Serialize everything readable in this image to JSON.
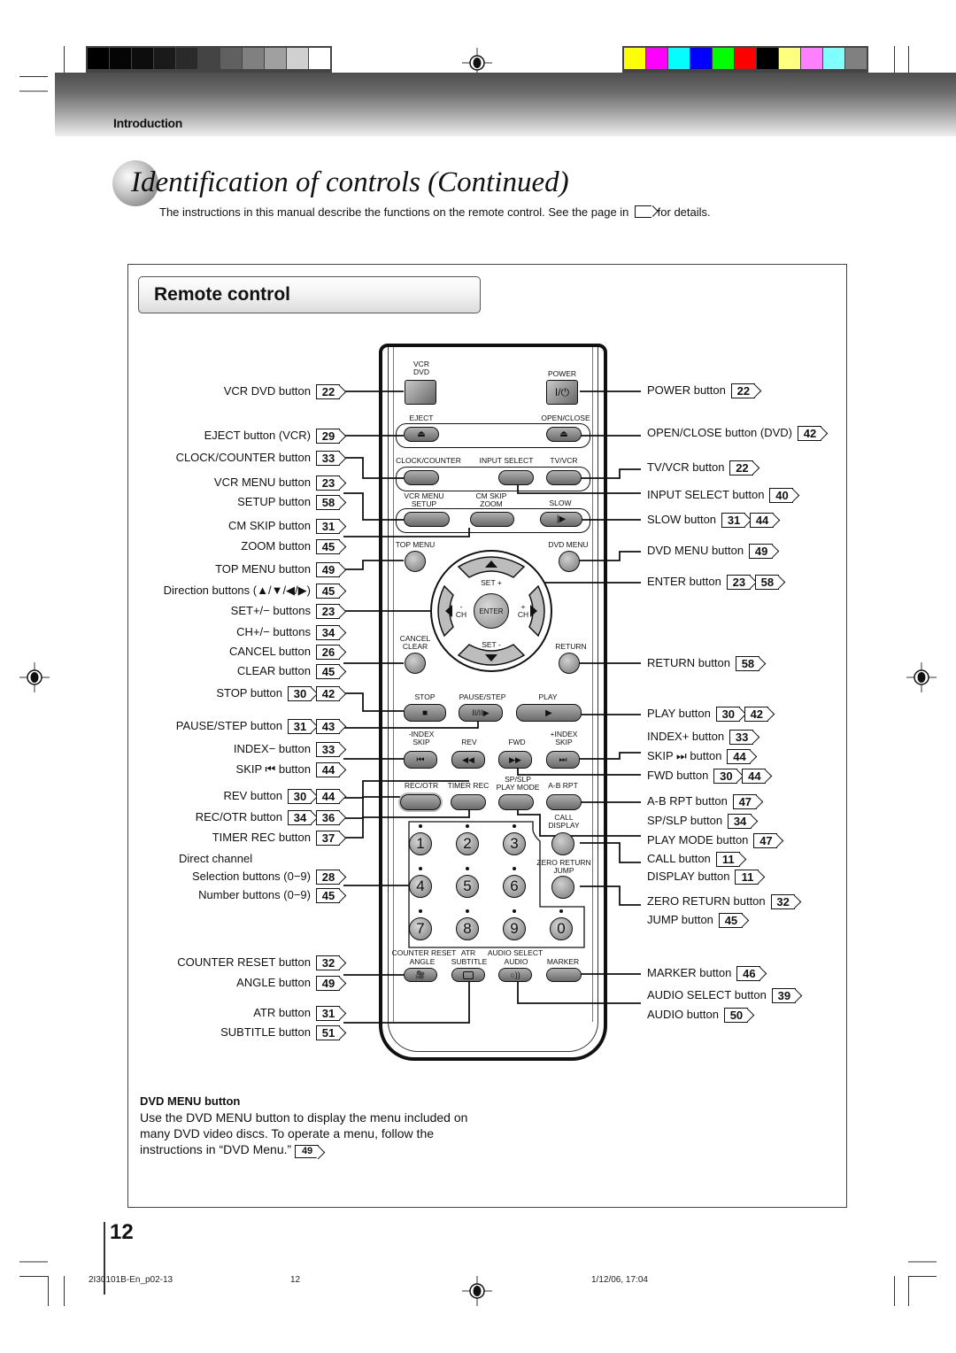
{
  "print_marks": {
    "grayscale_bar": [
      "#000000",
      "#050505",
      "#0d0d0d",
      "#1a1a1a",
      "#2a2a2a",
      "#444444",
      "#606060",
      "#808080",
      "#a0a0a0",
      "#d0d0d0",
      "#ffffff"
    ],
    "color_bar": [
      "#ffff00",
      "#ff00ff",
      "#00ffff",
      "#0000ff",
      "#00ff00",
      "#ff0000",
      "#000000",
      "#ffff80",
      "#ff80ff",
      "#80ffff",
      "#808080"
    ]
  },
  "header": {
    "section": "Introduction",
    "title": "Identification of controls (Continued)",
    "subtitle_before": "The instructions in this manual describe the functions on the remote control. See the page in",
    "subtitle_after": "for details."
  },
  "remote_section": {
    "heading": "Remote control"
  },
  "left_labels": [
    {
      "text": "VCR DVD button",
      "refs": [
        "22"
      ]
    },
    {
      "text": "EJECT button (VCR)",
      "refs": [
        "29"
      ]
    },
    {
      "text": "CLOCK/COUNTER button",
      "refs": [
        "33"
      ]
    },
    {
      "text": "VCR MENU button",
      "refs": [
        "23"
      ]
    },
    {
      "text": "SETUP button",
      "refs": [
        "58"
      ]
    },
    {
      "text": "CM SKIP button",
      "refs": [
        "31"
      ]
    },
    {
      "text": "ZOOM button",
      "refs": [
        "45"
      ]
    },
    {
      "text": "TOP MENU button",
      "refs": [
        "49"
      ]
    },
    {
      "text": "Direction buttons (▲/▼/◀/▶)",
      "refs": [
        "45"
      ]
    },
    {
      "text": "SET+/− buttons",
      "refs": [
        "23"
      ]
    },
    {
      "text": "CH+/− buttons",
      "refs": [
        "34"
      ]
    },
    {
      "text": "CANCEL button",
      "refs": [
        "26"
      ]
    },
    {
      "text": "CLEAR button",
      "refs": [
        "45"
      ]
    },
    {
      "text": "STOP button",
      "refs": [
        "30",
        "42"
      ]
    },
    {
      "text": "PAUSE/STEP button",
      "refs": [
        "31",
        "43"
      ]
    },
    {
      "text": "INDEX− button",
      "refs": [
        "33"
      ]
    },
    {
      "text": "SKIP ⏮ button",
      "refs": [
        "44"
      ]
    },
    {
      "text": "REV button",
      "refs": [
        "30",
        "44"
      ]
    },
    {
      "text": "REC/OTR button",
      "refs": [
        "34",
        "36"
      ]
    },
    {
      "text": "TIMER REC button",
      "refs": [
        "37"
      ]
    },
    {
      "text": "Direct channel",
      "refs": []
    },
    {
      "text": "Selection buttons (0−9)",
      "refs": [
        "28"
      ]
    },
    {
      "text": "Number buttons (0−9)",
      "refs": [
        "45"
      ]
    },
    {
      "text": "COUNTER RESET button",
      "refs": [
        "32"
      ]
    },
    {
      "text": "ANGLE button",
      "refs": [
        "49"
      ]
    },
    {
      "text": "ATR button",
      "refs": [
        "31"
      ]
    },
    {
      "text": "SUBTITLE button",
      "refs": [
        "51"
      ]
    }
  ],
  "right_labels": [
    {
      "text": "POWER button",
      "refs": [
        "22"
      ]
    },
    {
      "text": "OPEN/CLOSE button (DVD)",
      "refs": [
        "42"
      ]
    },
    {
      "text": "TV/VCR button",
      "refs": [
        "22"
      ]
    },
    {
      "text": "INPUT SELECT button",
      "refs": [
        "40"
      ]
    },
    {
      "text": "SLOW button",
      "refs": [
        "31",
        "44"
      ]
    },
    {
      "text": "DVD MENU button",
      "refs": [
        "49"
      ]
    },
    {
      "text": "ENTER button",
      "refs": [
        "23",
        "58"
      ]
    },
    {
      "text": "RETURN button",
      "refs": [
        "58"
      ]
    },
    {
      "text": "PLAY button",
      "refs": [
        "30",
        "42"
      ]
    },
    {
      "text": "INDEX+ button",
      "refs": [
        "33"
      ]
    },
    {
      "text": "SKIP ⏭ button",
      "refs": [
        "44"
      ]
    },
    {
      "text": "FWD button",
      "refs": [
        "30",
        "44"
      ]
    },
    {
      "text": "A-B RPT button",
      "refs": [
        "47"
      ]
    },
    {
      "text": "SP/SLP button",
      "refs": [
        "34"
      ]
    },
    {
      "text": "PLAY MODE button",
      "refs": [
        "47"
      ]
    },
    {
      "text": "CALL button",
      "refs": [
        "11"
      ]
    },
    {
      "text": "DISPLAY button",
      "refs": [
        "11"
      ]
    },
    {
      "text": "ZERO RETURN button",
      "refs": [
        "32"
      ]
    },
    {
      "text": "JUMP button",
      "refs": [
        "45"
      ]
    },
    {
      "text": "MARKER button",
      "refs": [
        "46"
      ]
    },
    {
      "text": "AUDIO SELECT button",
      "refs": [
        "39"
      ]
    },
    {
      "text": "AUDIO button",
      "refs": [
        "50"
      ]
    }
  ],
  "remote": {
    "vcr_dvd_label_1": "VCR",
    "vcr_dvd_label_2": "DVD",
    "power_label": "POWER",
    "power_glyph": "I/⏻",
    "eject_label": "EJECT",
    "open_close_label": "OPEN/CLOSE",
    "eject_glyph": "⏏",
    "clock_counter_label": "CLOCK/COUNTER",
    "input_select_label": "INPUT SELECT",
    "tv_vcr_label": "TV/VCR",
    "vcr_menu_label": "VCR MENU",
    "setup_label": "SETUP",
    "cm_skip_label": "CM SKIP",
    "zoom_label": "ZOOM",
    "slow_label": "SLOW",
    "slow_glyph": "|▶",
    "top_menu_label": "TOP MENU",
    "dvd_menu_label": "DVD MENU",
    "set_plus": "SET +",
    "set_minus": "SET -",
    "ch_minus": "-\nCH",
    "ch_minus_sign": "-",
    "ch_plus_sign": "+",
    "ch_text": "CH",
    "enter_label": "ENTER",
    "cancel_label": "CANCEL",
    "clear_label": "CLEAR",
    "return_label": "RETURN",
    "stop_label": "STOP",
    "pause_step_label": "PAUSE/STEP",
    "play_label": "PLAY",
    "stop_glyph": "■",
    "pause_glyph": "II/II▶",
    "play_glyph": "▶",
    "minus_index_label": "-INDEX",
    "skip_label": "SKIP",
    "rev_label": "REV",
    "fwd_label": "FWD",
    "plus_index_label": "+INDEX",
    "skip_back_glyph": "⏮",
    "rev_glyph": "◀◀",
    "fwd_glyph": "▶▶",
    "skip_fwd_glyph": "⏭",
    "rec_otr_label": "REC/OTR",
    "timer_rec_label": "TIMER REC",
    "sp_slp_label": "SP/SLP",
    "play_mode_label": "PLAY MODE",
    "ab_rpt_label": "A-B RPT",
    "call_label": "CALL",
    "display_label": "DISPLAY",
    "zero_return_label": "ZERO RETURN",
    "jump_label": "JUMP",
    "numbers": [
      "1",
      "2",
      "3",
      "4",
      "5",
      "6",
      "7",
      "8",
      "9",
      "0"
    ],
    "counter_reset_label": "COUNTER RESET",
    "atr_label": "ATR",
    "audio_select_label": "AUDIO SELECT",
    "angle_label": "ANGLE",
    "subtitle_label": "SUBTITLE",
    "audio_label": "AUDIO",
    "marker_label": "MARKER"
  },
  "description": {
    "heading": "DVD MENU button",
    "body": "Use the DVD MENU button to display the menu included on many DVD video discs. To operate a menu, follow the instructions in “DVD Menu.”",
    "ref": "49"
  },
  "footer": {
    "page_number": "12",
    "file": "2I30101B-En_p02-13",
    "page": "12",
    "timestamp": "1/12/06, 17:04"
  }
}
